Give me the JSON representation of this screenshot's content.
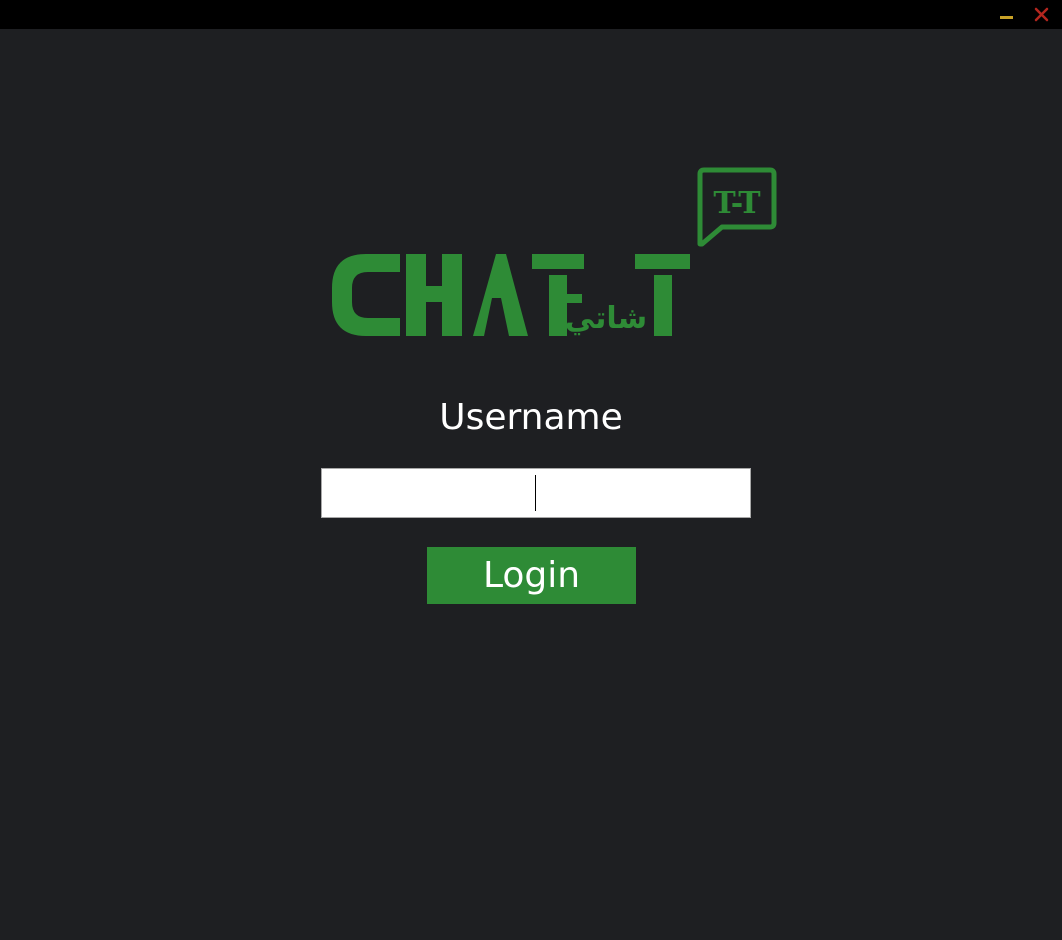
{
  "window": {
    "controls": {
      "minimize_icon": "minimize-icon",
      "close_icon": "close-icon",
      "minimize_color": "#c9a227",
      "close_color": "#b3261e"
    }
  },
  "logo": {
    "brand_text": "CHAT-T",
    "bubble_text": "T-T",
    "arabic_text": "شاتي",
    "color": "#2e8b36"
  },
  "form": {
    "username_label": "Username",
    "username_value": "",
    "login_label": "Login"
  },
  "theme": {
    "background": "#1e1f22",
    "accent": "#2e8b36",
    "text": "#ffffff"
  }
}
